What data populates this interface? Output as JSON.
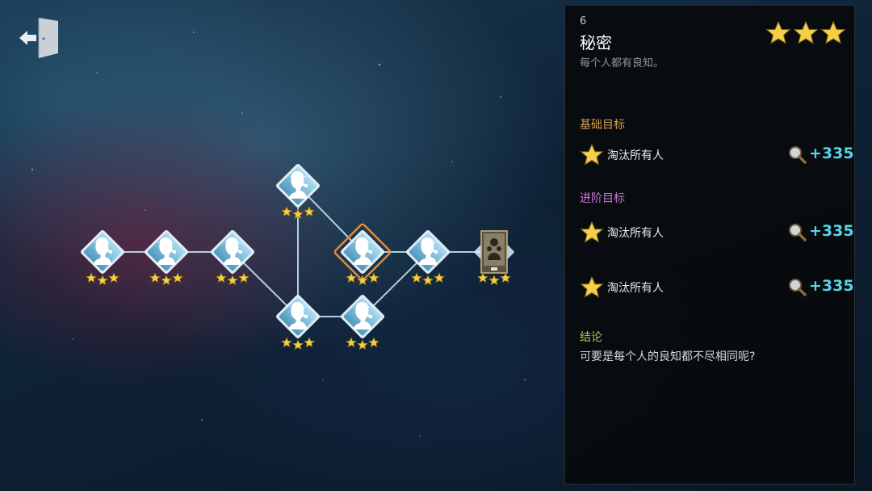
{
  "chapter": {
    "number": "6",
    "title": "秘密",
    "description": "每个人都有良知。",
    "rating_stars": 3
  },
  "basic_goals": {
    "label": "基础目标",
    "items": [
      {
        "text": "淘汰所有人",
        "reward": "+335"
      }
    ]
  },
  "advanced_goals": {
    "label": "进阶目标",
    "items": [
      {
        "text": "淘汰所有人",
        "reward": "+335"
      },
      {
        "text": "淘汰所有人",
        "reward": "+335"
      }
    ]
  },
  "conclusion": {
    "label": "结论",
    "text": "可要是每个人的良知都不尽相同呢?"
  },
  "map_nodes": [
    {
      "id": "node-1",
      "stars": 3,
      "type": "detective",
      "selected": false
    },
    {
      "id": "node-2",
      "stars": 3,
      "type": "detective",
      "selected": false
    },
    {
      "id": "node-3",
      "stars": 3,
      "type": "detective",
      "selected": false
    },
    {
      "id": "node-4",
      "stars": 3,
      "type": "detective",
      "selected": false
    },
    {
      "id": "node-5",
      "stars": 3,
      "type": "detective",
      "selected": false
    },
    {
      "id": "node-6",
      "stars": 3,
      "type": "detective",
      "selected": true
    },
    {
      "id": "node-7",
      "stars": 3,
      "type": "detective",
      "selected": false
    },
    {
      "id": "node-8",
      "stars": 3,
      "type": "detective",
      "selected": false
    },
    {
      "id": "node-9",
      "stars": 3,
      "type": "character-card",
      "selected": false
    }
  ],
  "colors": {
    "accent_cyan": "#58d4e8",
    "star_gold": "#f4d04a",
    "basic_label": "#d9a04a",
    "advanced_label": "#c67ad8",
    "conclusion_label": "#9bcf5a",
    "selected_border": "#e08a3a"
  },
  "icons": {
    "exit": "exit-door-icon",
    "reward": "magnifier-icon",
    "goal": "star-icon",
    "node": "detective-silhouette-icon"
  }
}
